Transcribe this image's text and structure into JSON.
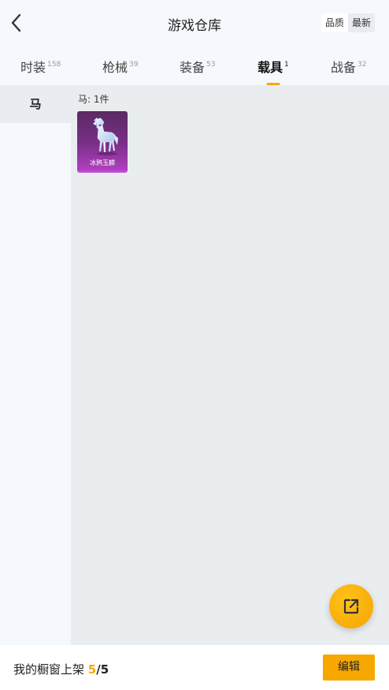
{
  "header": {
    "title": "游戏仓库",
    "sort_options": [
      {
        "label": "品质",
        "active": true
      },
      {
        "label": "最新",
        "active": false
      }
    ]
  },
  "tabs": [
    {
      "label": "时装",
      "count": "158",
      "active": false
    },
    {
      "label": "枪械",
      "count": "39",
      "active": false
    },
    {
      "label": "装备",
      "count": "53",
      "active": false
    },
    {
      "label": "载具",
      "count": "1",
      "active": true
    },
    {
      "label": "战备",
      "count": "32",
      "active": false
    }
  ],
  "sidebar": {
    "items": [
      {
        "label": "马",
        "active": true
      }
    ]
  },
  "content": {
    "group_label": "马: 1件",
    "items": [
      {
        "name": "冰鸦玉麟",
        "rarity_color": "#c14ad6"
      }
    ]
  },
  "bottom_bar": {
    "shelf_label": "我的橱窗上架",
    "shelf_used": "5",
    "shelf_separator": "/",
    "shelf_total": "5",
    "edit_label": "编辑"
  },
  "colors": {
    "accent": "#f6a800",
    "rarity_purple": "#c14ad6"
  },
  "icons": {
    "back": "chevron-left-icon",
    "share": "external-link-icon"
  }
}
